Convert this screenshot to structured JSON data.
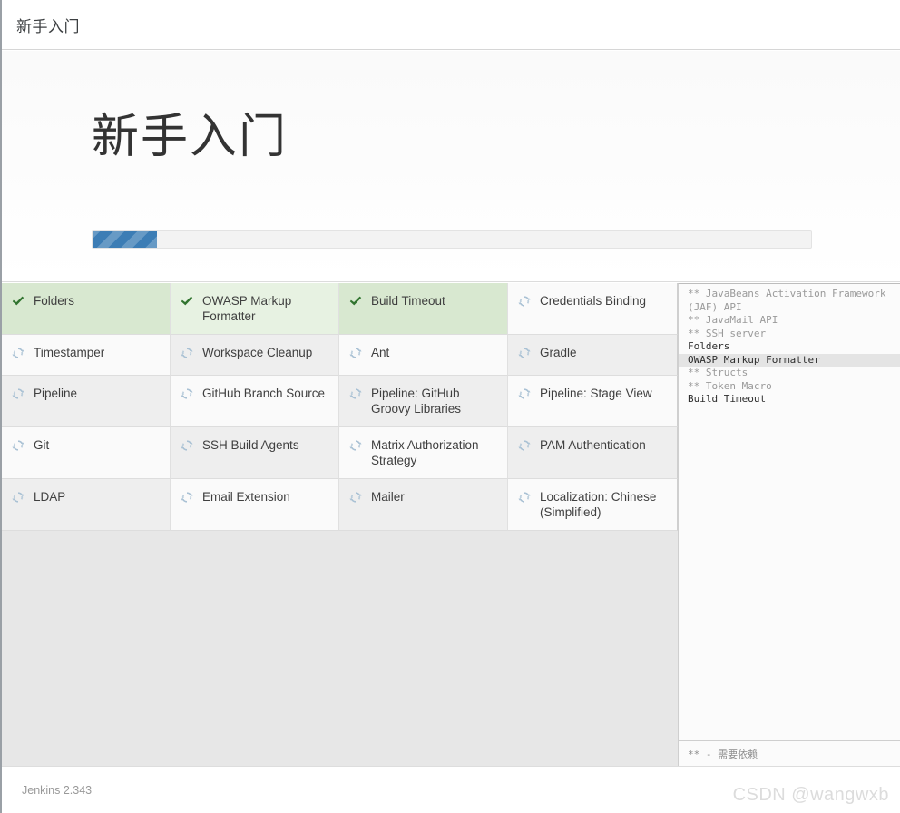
{
  "window": {
    "title": "新手入门"
  },
  "hero": {
    "heading": "新手入门",
    "progress_percent": 9,
    "progress_fill_color": "#3c7db5",
    "progress_track_color": "#f3f3f3"
  },
  "icons": {
    "done": "check-icon",
    "pending": "spinner-refresh-icon"
  },
  "colors": {
    "done_cell_bg": "#d8e8d0",
    "done_cell_bg_alt": "#e7f2e2",
    "check_green": "#31742f",
    "spinner_blue": "#a9c1d4"
  },
  "plugin_grid": {
    "columns": 4,
    "rows": [
      [
        {
          "name": "Folders",
          "status": "done"
        },
        {
          "name": "OWASP Markup Formatter",
          "status": "done"
        },
        {
          "name": "Build Timeout",
          "status": "done"
        },
        {
          "name": "Credentials Binding",
          "status": "pending"
        }
      ],
      [
        {
          "name": "Timestamper",
          "status": "pending"
        },
        {
          "name": "Workspace Cleanup",
          "status": "pending"
        },
        {
          "name": "Ant",
          "status": "pending"
        },
        {
          "name": "Gradle",
          "status": "pending"
        }
      ],
      [
        {
          "name": "Pipeline",
          "status": "pending"
        },
        {
          "name": "GitHub Branch Source",
          "status": "pending"
        },
        {
          "name": "Pipeline: GitHub Groovy Libraries",
          "status": "pending"
        },
        {
          "name": "Pipeline: Stage View",
          "status": "pending"
        }
      ],
      [
        {
          "name": "Git",
          "status": "pending"
        },
        {
          "name": "SSH Build Agents",
          "status": "pending"
        },
        {
          "name": "Matrix Authorization Strategy",
          "status": "pending"
        },
        {
          "name": "PAM Authentication",
          "status": "pending"
        }
      ],
      [
        {
          "name": "LDAP",
          "status": "pending"
        },
        {
          "name": "Email Extension",
          "status": "pending"
        },
        {
          "name": "Mailer",
          "status": "pending"
        },
        {
          "name": "Localization: Chinese (Simplified)",
          "status": "pending"
        }
      ]
    ]
  },
  "log_panel": {
    "lines": [
      {
        "text": "** JavaBeans Activation Framework (JAF) API",
        "kind": "dependency"
      },
      {
        "text": "** JavaMail API",
        "kind": "dependency"
      },
      {
        "text": "** SSH server",
        "kind": "dependency"
      },
      {
        "text": "Folders",
        "kind": "plugin"
      },
      {
        "text": "OWASP Markup Formatter",
        "kind": "active"
      },
      {
        "text": "** Structs",
        "kind": "dependency"
      },
      {
        "text": "** Token Macro",
        "kind": "dependency"
      },
      {
        "text": "Build Timeout",
        "kind": "plugin"
      }
    ],
    "legend": "** - 需要依赖"
  },
  "footer": {
    "version": "Jenkins 2.343"
  },
  "watermark": {
    "text": "CSDN @wangwxb"
  }
}
